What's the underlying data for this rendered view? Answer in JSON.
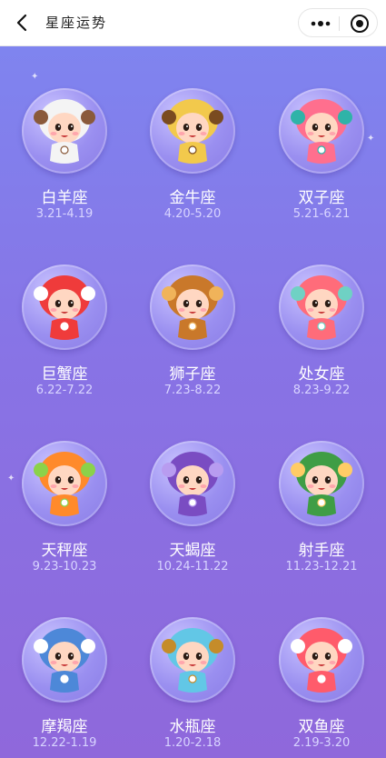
{
  "header": {
    "title": "星座运势",
    "back_icon": "chevron-left-icon",
    "more_icon": "more-dots-icon",
    "close_icon": "target-icon"
  },
  "zodiac": [
    {
      "name": "白羊座",
      "dates": "3.21-4.19",
      "icon": "aries-mascot-icon",
      "color": "#f4f4f4",
      "accent": "#8a5a3b"
    },
    {
      "name": "金牛座",
      "dates": "4.20-5.20",
      "icon": "taurus-mascot-icon",
      "color": "#f2c94c",
      "accent": "#7a4b20"
    },
    {
      "name": "双子座",
      "dates": "5.21-6.21",
      "icon": "gemini-mascot-icon",
      "color": "#ff6f8e",
      "accent": "#2fb3a8"
    },
    {
      "name": "巨蟹座",
      "dates": "6.22-7.22",
      "icon": "cancer-mascot-icon",
      "color": "#ef3b3b",
      "accent": "#ffffff"
    },
    {
      "name": "狮子座",
      "dates": "7.23-8.22",
      "icon": "leo-mascot-icon",
      "color": "#c9782a",
      "accent": "#f0b35a"
    },
    {
      "name": "处女座",
      "dates": "8.23-9.22",
      "icon": "virgo-mascot-icon",
      "color": "#ff6c7a",
      "accent": "#6fd1c4"
    },
    {
      "name": "天秤座",
      "dates": "9.23-10.23",
      "icon": "libra-mascot-icon",
      "color": "#ff8a2b",
      "accent": "#8bd24a"
    },
    {
      "name": "天蝎座",
      "dates": "10.24-11.22",
      "icon": "scorpio-mascot-icon",
      "color": "#7a4cc2",
      "accent": "#b89cf0"
    },
    {
      "name": "射手座",
      "dates": "11.23-12.21",
      "icon": "sagittarius-mascot-icon",
      "color": "#3f9d45",
      "accent": "#ffcc66"
    },
    {
      "name": "摩羯座",
      "dates": "12.22-1.19",
      "icon": "capricorn-mascot-icon",
      "color": "#4d88d8",
      "accent": "#ffffff"
    },
    {
      "name": "水瓶座",
      "dates": "1.20-2.18",
      "icon": "aquarius-mascot-icon",
      "color": "#62c7e6",
      "accent": "#c58c2a"
    },
    {
      "name": "双鱼座",
      "dates": "2.19-3.20",
      "icon": "pisces-mascot-icon",
      "color": "#ff5b6b",
      "accent": "#ffffff"
    }
  ]
}
